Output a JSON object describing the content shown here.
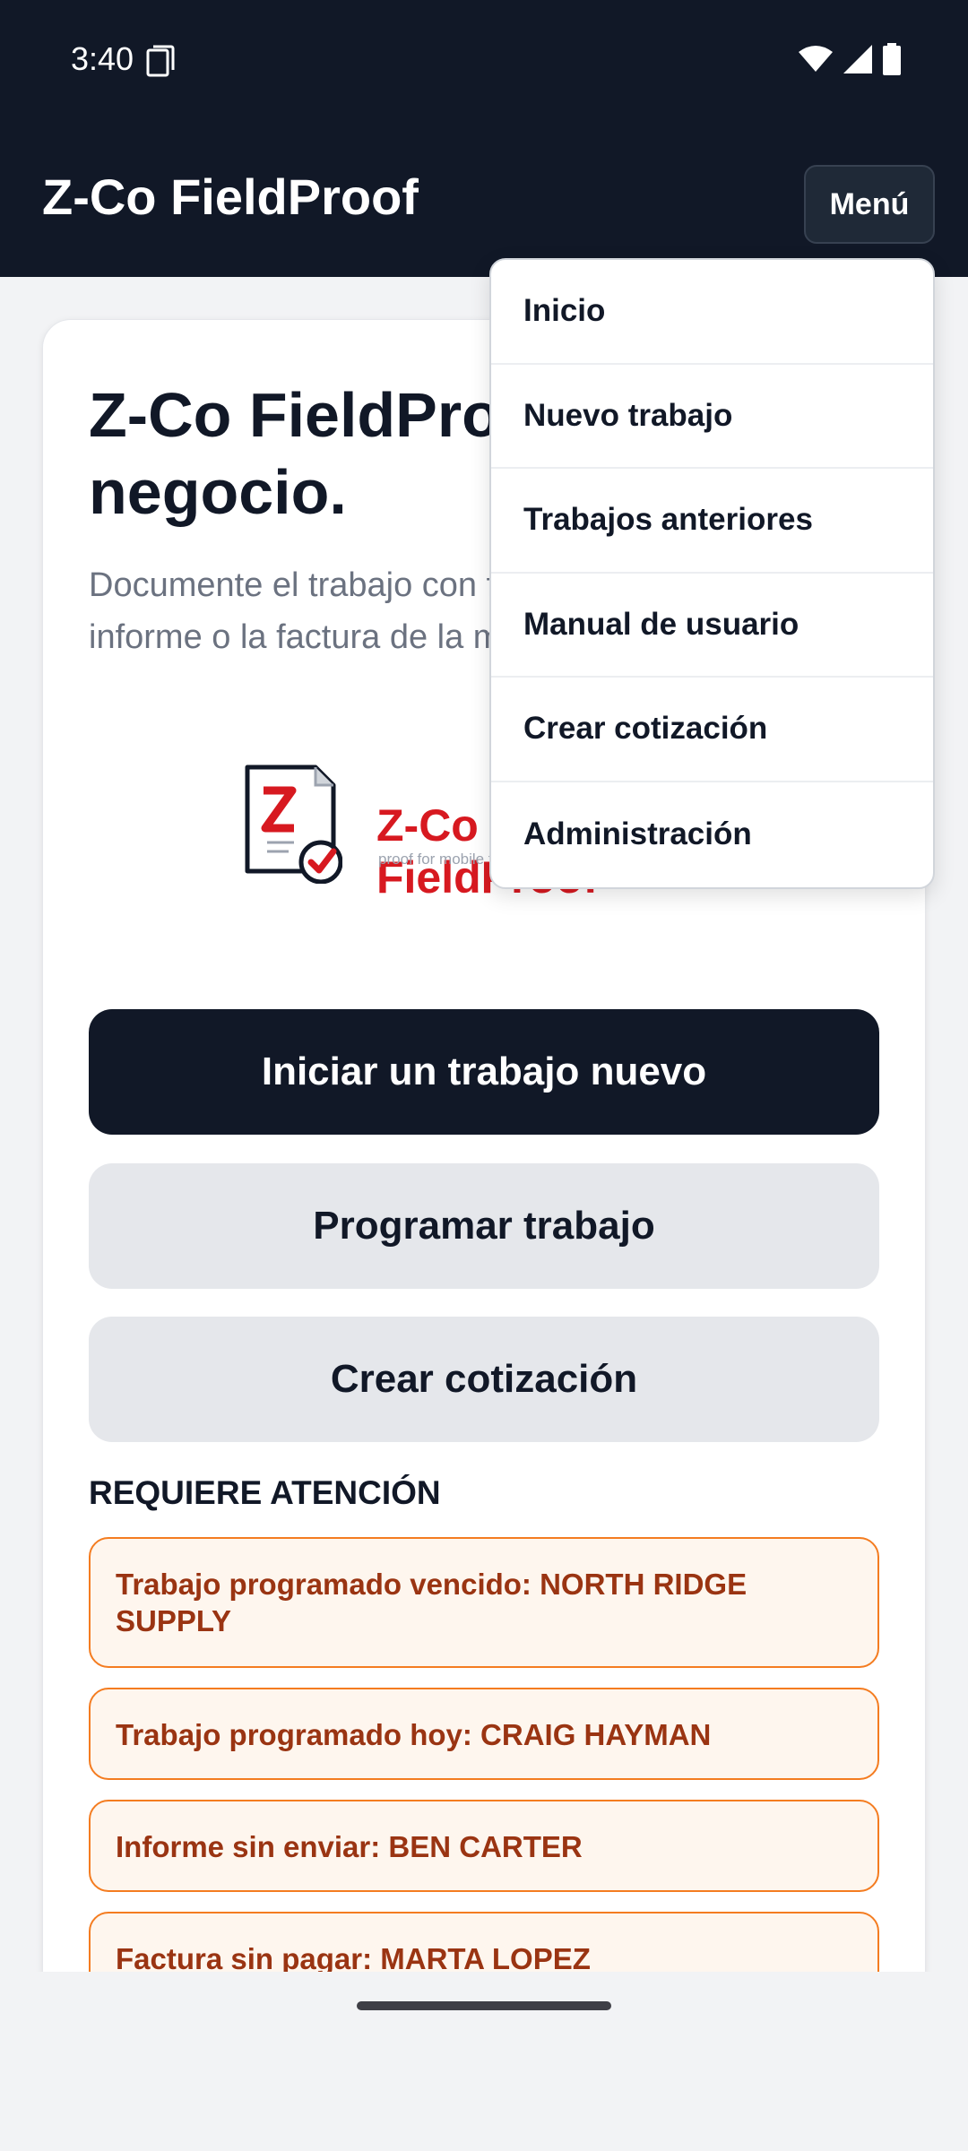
{
  "status": {
    "time": "3:40"
  },
  "app": {
    "title": "Z-Co FieldProof",
    "menu_label": "Menú"
  },
  "hero": {
    "title": "Z-Co FieldProof para su negocio.",
    "description": "Documente el trabajo con fotos y firmas. Envíe el informe o la factura de la misma manera."
  },
  "logo": {
    "brand": "Z-Co FieldProof",
    "tagline": "proof for mobile field service"
  },
  "actions": {
    "start_job": "Iniciar un trabajo nuevo",
    "schedule_job": "Programar trabajo",
    "create_quote": "Crear cotización"
  },
  "attention": {
    "title": "REQUIERE ATENCIÓN",
    "items": [
      "Trabajo programado vencido: NORTH RIDGE SUPPLY",
      "Trabajo programado hoy: CRAIG HAYMAN",
      "Informe sin enviar: BEN CARTER",
      "Factura sin pagar: MARTA LOPEZ"
    ]
  },
  "menu": {
    "items": [
      "Inicio",
      "Nuevo trabajo",
      "Trabajos anteriores",
      "Manual de usuario",
      "Crear cotización",
      "Administración"
    ]
  },
  "colors": {
    "header_bg": "#111827",
    "primary_button": "#111827",
    "secondary_button": "#e5e7eb",
    "alert_border": "#f47c20",
    "alert_bg": "#fef6ee",
    "alert_text": "#9a3412",
    "brand_red": "#d71920"
  },
  "icons": {
    "status": [
      "sim-card-icon",
      "wifi-icon",
      "cellular-signal-icon",
      "battery-icon"
    ],
    "logo": "document-checkmark-icon"
  }
}
